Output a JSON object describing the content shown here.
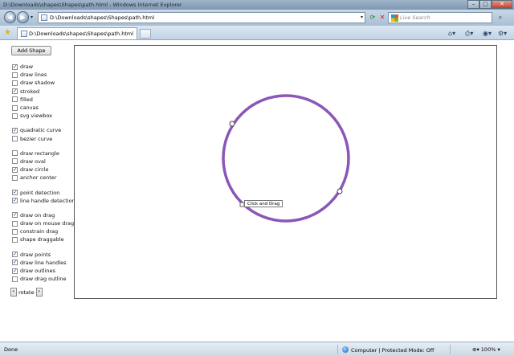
{
  "window": {
    "title": "D:\\Downloads\\shapes\\Shapes\\path.html - Windows Internet Explorer",
    "controls": [
      "minimize",
      "maximize",
      "close"
    ]
  },
  "address_bar": {
    "url": "D:\\Downloads\\shapes\\Shapes\\path.html",
    "search_placeholder": "Live Search"
  },
  "tabs": [
    {
      "label": "D:\\Downloads\\shapes\\Shapes\\path.html"
    }
  ],
  "toolbar": {
    "add_shape_label": "Add Shape",
    "rotate_label": "rotate",
    "rotate_left": "<",
    "rotate_right": ">"
  },
  "options": [
    {
      "label": "draw",
      "checked": true,
      "group": 1
    },
    {
      "label": "draw lines",
      "checked": false,
      "group": 1
    },
    {
      "label": "draw shadow",
      "checked": false,
      "group": 1
    },
    {
      "label": "stroked",
      "checked": true,
      "group": 1
    },
    {
      "label": "filled",
      "checked": false,
      "group": 1
    },
    {
      "label": "canvas",
      "checked": false,
      "group": 1
    },
    {
      "label": "svg viewbox",
      "checked": false,
      "group": 1
    },
    {
      "label": "quadratic curve",
      "checked": true,
      "group": 2
    },
    {
      "label": "bezier curve",
      "checked": false,
      "group": 2
    },
    {
      "label": "draw rectangle",
      "checked": false,
      "group": 3
    },
    {
      "label": "draw oval",
      "checked": false,
      "group": 3
    },
    {
      "label": "draw circle",
      "checked": true,
      "group": 3
    },
    {
      "label": "anchor center",
      "checked": false,
      "group": 3
    },
    {
      "label": "point detection",
      "checked": true,
      "group": 4
    },
    {
      "label": "line handle detection",
      "checked": true,
      "group": 4
    },
    {
      "label": "draw on drag",
      "checked": true,
      "group": 5
    },
    {
      "label": "draw on mouse drag",
      "checked": false,
      "group": 5
    },
    {
      "label": "constrain drag",
      "checked": false,
      "group": 5
    },
    {
      "label": "shape draggable",
      "checked": false,
      "group": 5
    },
    {
      "label": "draw points",
      "checked": true,
      "group": 6
    },
    {
      "label": "draw line handles",
      "checked": true,
      "group": 6
    },
    {
      "label": "draw outlines",
      "checked": true,
      "group": 6
    },
    {
      "label": "draw drag outline",
      "checked": false,
      "group": 6
    }
  ],
  "canvas": {
    "tooltip": "Click and Drag",
    "shape_stroke_color": "#8a56b8"
  },
  "statusbar": {
    "status": "Done",
    "zone": "Computer | Protected Mode: Off",
    "zoom": "100%"
  }
}
